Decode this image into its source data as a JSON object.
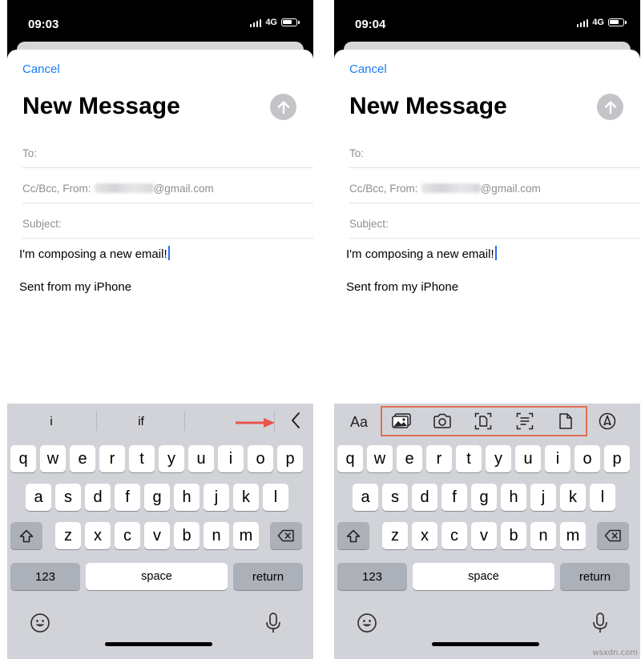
{
  "left": {
    "time": "09:03",
    "network": "4G",
    "cancel_label": "Cancel",
    "title": "New Message",
    "to_label": "To:",
    "ccbcc_label": "Cc/Bcc, From:",
    "email_domain": "@gmail.com",
    "subject_label": "Subject:",
    "body_text": "I'm composing a new email!",
    "signature": "Sent from my iPhone",
    "suggestions": [
      "i",
      "if"
    ],
    "space_label": "space",
    "return_label": "return",
    "numbers_label": "123"
  },
  "right": {
    "time": "09:04",
    "network": "4G",
    "cancel_label": "Cancel",
    "title": "New Message",
    "to_label": "To:",
    "ccbcc_label": "Cc/Bcc, From:",
    "email_domain": "@gmail.com",
    "subject_label": "Subject:",
    "body_text": "I'm composing a new email!",
    "signature": "Sent from my iPhone",
    "format_label": "Aa",
    "tools": [
      "photo-library-icon",
      "camera-icon",
      "scan-document-icon",
      "scan-text-icon",
      "attach-file-icon",
      "markup-icon"
    ],
    "space_label": "space",
    "return_label": "return",
    "numbers_label": "123"
  },
  "keyboard_rows": [
    [
      "q",
      "w",
      "e",
      "r",
      "t",
      "y",
      "u",
      "i",
      "o",
      "p"
    ],
    [
      "a",
      "s",
      "d",
      "f",
      "g",
      "h",
      "j",
      "k",
      "l"
    ],
    [
      "z",
      "x",
      "c",
      "v",
      "b",
      "n",
      "m"
    ]
  ],
  "colors": {
    "accent": "#1a7cf5",
    "highlight": "#e06d55",
    "keyboard_bg": "#d1d3d9"
  },
  "watermark": "wsxdn.com"
}
